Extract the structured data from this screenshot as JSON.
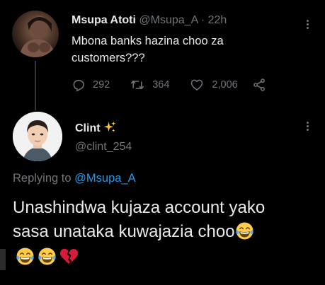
{
  "parent_tweet": {
    "author_name": "Msupa Atoti",
    "author_handle": "@Msupa_A",
    "separator": "·",
    "time": "22h",
    "text": "Mbona banks hazina choo za customers???",
    "reply_count": "292",
    "retweet_count": "364",
    "like_count": "2,006"
  },
  "reply_tweet": {
    "author_name": "Clint",
    "author_handle": "@clint_254",
    "replying_prefix": "Replying to",
    "replying_mention": "@Msupa_A",
    "text_line1": "Unashindwa kujaza account yako",
    "text_line2": "sasa unataka kuwajazia choo",
    "trailing_emojis": [
      "tears-of-joy",
      "tears-of-joy",
      "broken-heart"
    ]
  },
  "icons": {
    "name_badge": "sparkles-icon",
    "reply": "reply-icon",
    "retweet": "retweet-icon",
    "like": "heart-icon",
    "share": "share-icon",
    "more": "more-icon"
  },
  "colors": {
    "background": "#000000",
    "text": "#e7e9ea",
    "muted": "#71767b",
    "link": "#1d9bf0",
    "sparkle": "#f5c542",
    "broken_heart": "#d81b3a"
  }
}
